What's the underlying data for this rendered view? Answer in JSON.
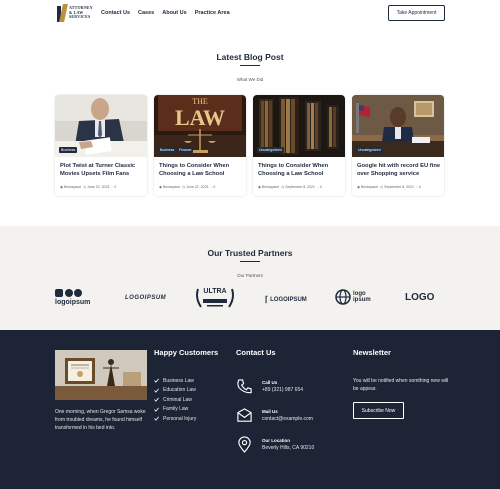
{
  "header": {
    "logo_line1": "ATTORNEY",
    "logo_line2": "& LAW",
    "logo_line3": "SERVICES",
    "nav": [
      "Contact Us",
      "Cases",
      "About Us",
      "Practice Area"
    ],
    "cta": "Take Appointment"
  },
  "blog": {
    "title": "Latest Blog Post",
    "subtitle": "What We Did",
    "posts": [
      {
        "title": "Plot Twist at Turner Classic Movies Upsets Film Fans",
        "tags": [
          "Business"
        ],
        "author": "Brickspace",
        "date": "June 22, 2023",
        "comments": "0"
      },
      {
        "title": "Things to Consider When Choosing a Law School",
        "tags": [
          "Business",
          "Finance"
        ],
        "author": "Brickspace",
        "date": "June 22, 2023",
        "comments": "0"
      },
      {
        "title": "Things to Consider When Choosing a Law School",
        "tags": [
          "Uncategorized"
        ],
        "author": "Brickspace",
        "date": "September 8, 2021",
        "comments": "0"
      },
      {
        "title": "Google hit with record EU fine over Shopping service",
        "tags": [
          "Uncategorized"
        ],
        "author": "Brickspace",
        "date": "September 8, 2021",
        "comments": "0"
      }
    ]
  },
  "partners": {
    "title": "Our Trusted Partners",
    "subtitle": "Our Partners",
    "logos": [
      "logoipsum",
      "LOGOIPSUM",
      "ULTRA",
      "LOGOIPSUM",
      "logo ipsum",
      "LOGO"
    ]
  },
  "footer": {
    "about_text": "One morning, when Gregor Samsa woke from troubled dreams, he found himself transformed in his bed into.",
    "happy_title": "Happy Customers",
    "happy_items": [
      "Business Law",
      "Education Law",
      "Criminal Law",
      "Family Law",
      "Personal Injury"
    ],
    "contact_title": "Contact Us",
    "contacts": [
      {
        "label": "Call Us",
        "value": "+89 (321) 987 654"
      },
      {
        "label": "Mail Us",
        "value": "contact@example.com"
      },
      {
        "label": "Our Location",
        "value": "Beverly Hills, CA 90210"
      }
    ],
    "newsletter_title": "Newsletter",
    "newsletter_text": "You will be notified when somthing new will be appear.",
    "subscribe": "Subscribe Now"
  },
  "colors": {
    "navy": "#1d2436",
    "gold": "#b9913f",
    "beige": "#f4f2ee"
  }
}
